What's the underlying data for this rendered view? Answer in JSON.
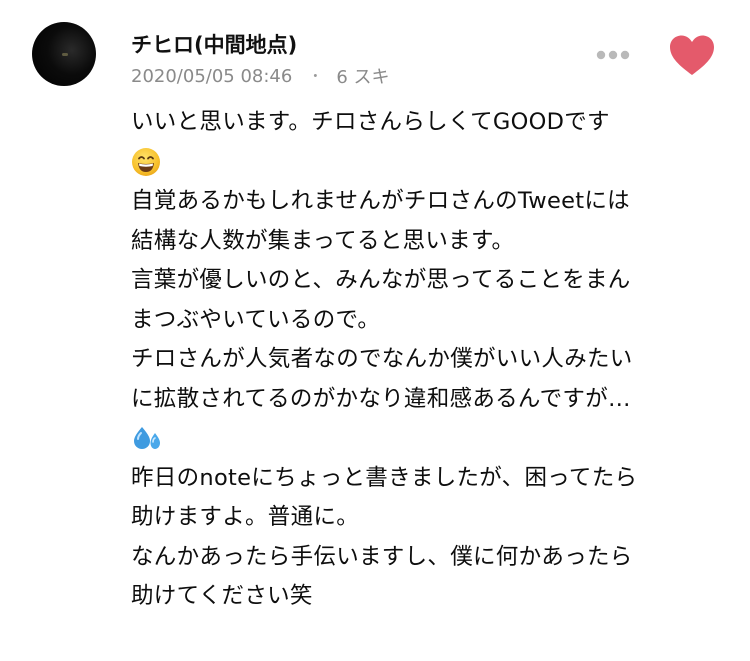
{
  "comment": {
    "author": "チヒロ(中間地点)",
    "date": "2020/05/05 08:46",
    "separator": "・",
    "likes": "6 スキ",
    "like_color": "#e45a6b",
    "avatar": "avatar-image",
    "lines": [
      "いいと思います。チロさんらしくてGOODです",
      "自覚あるかもしれませんがチロさんのTweetには",
      "結構な人数が集まってると思います。",
      "言葉が優しいのと、みんなが思ってることをまん",
      "まつぶやいているので。",
      "チロさんが人気者なのでなんか僕がいい人みたい",
      "に拡散されてるのがかなり違和感あるんですが…",
      "昨日のnoteにちょっと書きましたが、困ってたら",
      "助けますよ。普通に。",
      "なんかあったら手伝いますし、僕に何かあったら",
      "助けてください笑"
    ],
    "emojis": [
      "grinning-face-emoji",
      "sweat-droplets-emoji"
    ]
  }
}
